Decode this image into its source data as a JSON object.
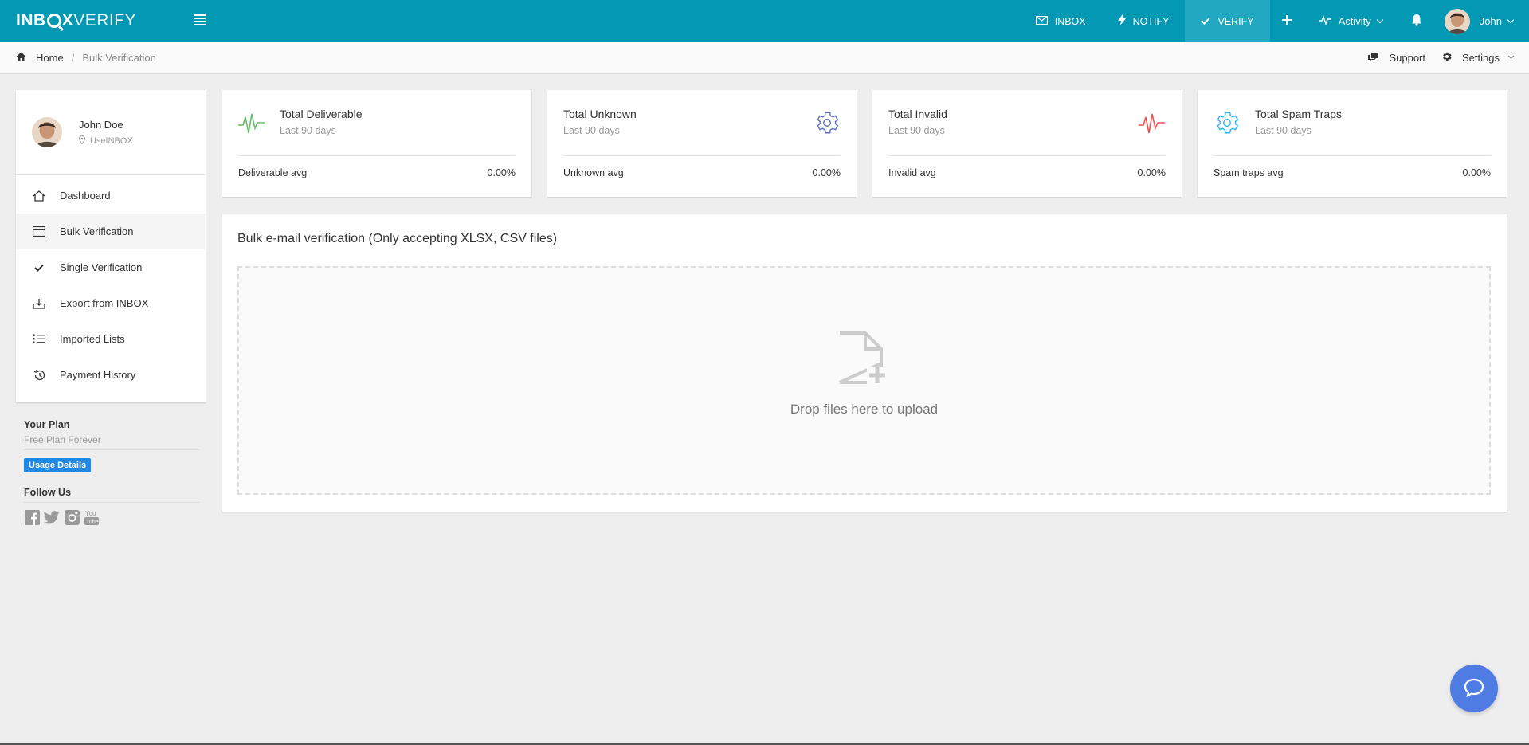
{
  "brand": {
    "part1": "INB",
    "part2": "X",
    "part3": "VERIFY"
  },
  "nav": {
    "items": [
      {
        "label": "INBOX",
        "icon": "mail-icon"
      },
      {
        "label": "NOTIFY",
        "icon": "bolt-icon"
      },
      {
        "label": "VERIFY",
        "icon": "check-icon",
        "active": true
      }
    ],
    "activity_label": "Activity",
    "user_label": "John"
  },
  "breadcrumb": {
    "home": "Home",
    "separator": "/",
    "current": "Bulk Verification",
    "support": "Support",
    "settings": "Settings"
  },
  "profile": {
    "name": "John Doe",
    "location": "UseINBOX"
  },
  "sidebar": {
    "items": [
      {
        "label": "Dashboard",
        "icon": "home-icon"
      },
      {
        "label": "Bulk Verification",
        "icon": "table-icon",
        "active": true
      },
      {
        "label": "Single Verification",
        "icon": "check-icon"
      },
      {
        "label": "Export from INBOX",
        "icon": "download-tray-icon"
      },
      {
        "label": "Imported Lists",
        "icon": "list-icon"
      },
      {
        "label": "Payment History",
        "icon": "history-icon"
      }
    ]
  },
  "plan": {
    "title": "Your Plan",
    "name": "Free Plan Forever",
    "usage_button": "Usage Details",
    "follow_title": "Follow Us",
    "socials": [
      "facebook-icon",
      "twitter-icon",
      "instagram-icon",
      "youtube-icon"
    ]
  },
  "stats": [
    {
      "title": "Total Deliverable",
      "period": "Last 90 days",
      "avg_label": "Deliverable avg",
      "avg_value": "0.00%",
      "icon": "pulse-icon",
      "color": "#66bb6a"
    },
    {
      "title": "Total Unknown",
      "period": "Last 90 days",
      "avg_label": "Unknown avg",
      "avg_value": "0.00%",
      "icon": "gear-icon",
      "color": "#5c6bc0"
    },
    {
      "title": "Total Invalid",
      "period": "Last 90 days",
      "avg_label": "Invalid avg",
      "avg_value": "0.00%",
      "icon": "pulse-icon",
      "color": "#ef5350"
    },
    {
      "title": "Total Spam Traps",
      "period": "Last 90 days",
      "avg_label": "Spam traps avg",
      "avg_value": "0.00%",
      "icon": "gear-icon",
      "color": "#29b6f6"
    }
  ],
  "upload": {
    "title": "Bulk e-mail verification (Only accepting XLSX, CSV files)",
    "drop_text": "Drop files here to upload"
  },
  "colors": {
    "primary": "#0398b3",
    "accent": "#1e88e5",
    "chat": "#4e7ce3"
  }
}
